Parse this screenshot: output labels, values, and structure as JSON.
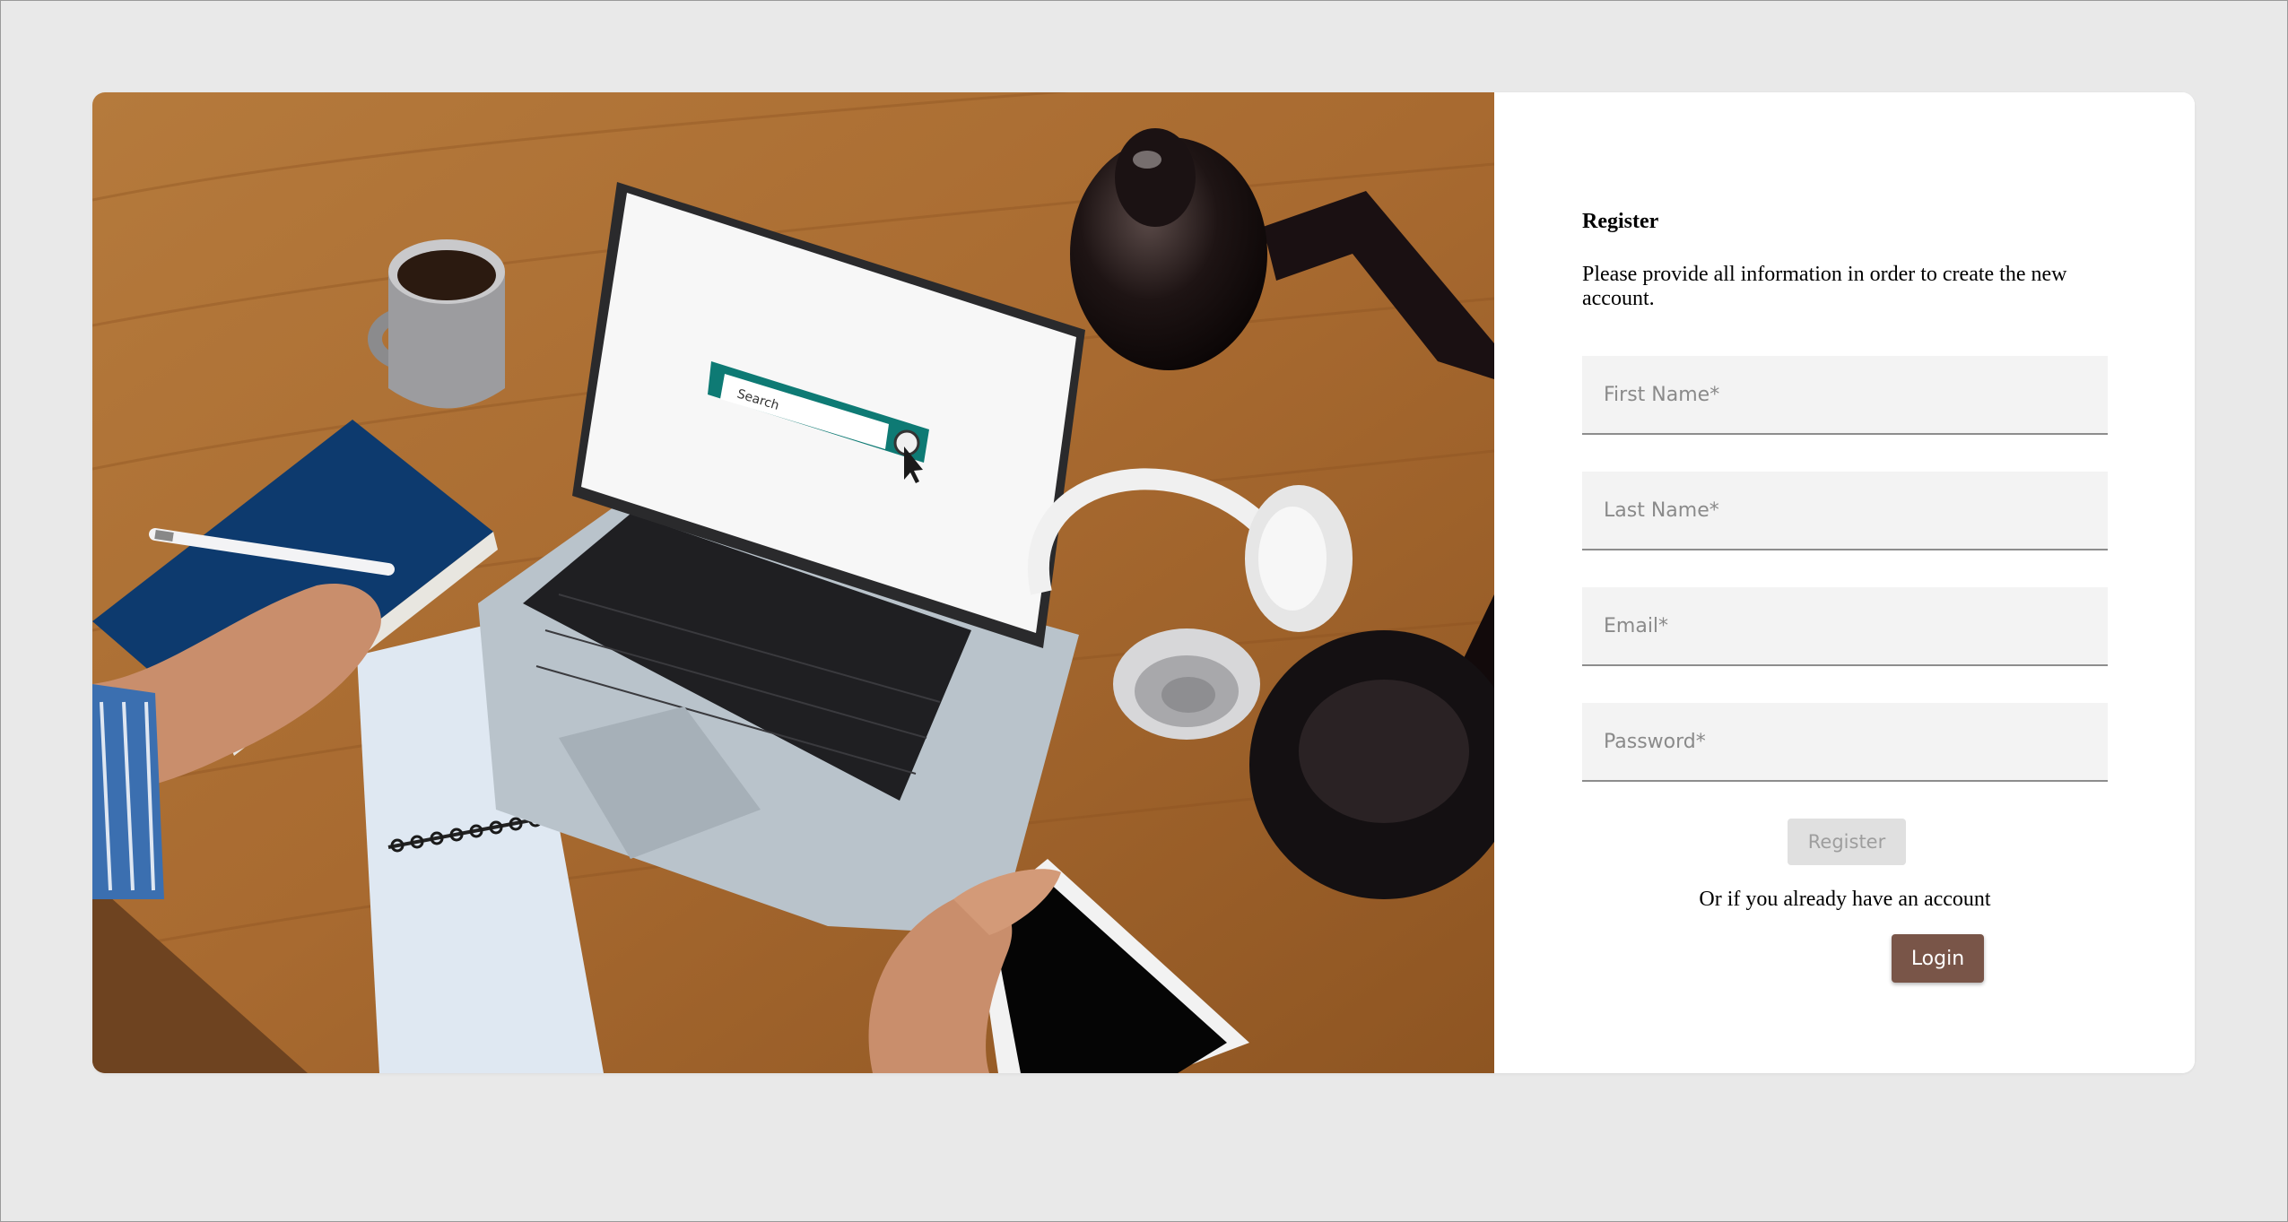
{
  "register": {
    "title": "Register",
    "description": "Please provide all information in order to create the new account.",
    "fields": [
      {
        "placeholder": "First Name*",
        "value": ""
      },
      {
        "placeholder": "Last Name*",
        "value": ""
      },
      {
        "placeholder": "Email*",
        "value": ""
      },
      {
        "placeholder": "Password*",
        "value": ""
      }
    ],
    "register_label": "Register",
    "or_text": "Or if you already have an account",
    "login_label": "Login"
  },
  "hero": {
    "search_label": "Search",
    "icons": [
      "laptop-icon",
      "coffee-mug-icon",
      "desk-lamp-icon",
      "headphones-icon",
      "notebook-icon",
      "pen-icon",
      "tablet-icon",
      "cursor-icon"
    ]
  },
  "colors": {
    "page_background": "#e9e9e9",
    "card_background": "#ffffff",
    "field_background": "#f3f3f3",
    "login_button": "#795548",
    "register_button_disabled": "#e0e0e0",
    "search_bar_accent": "#0e7a74"
  }
}
